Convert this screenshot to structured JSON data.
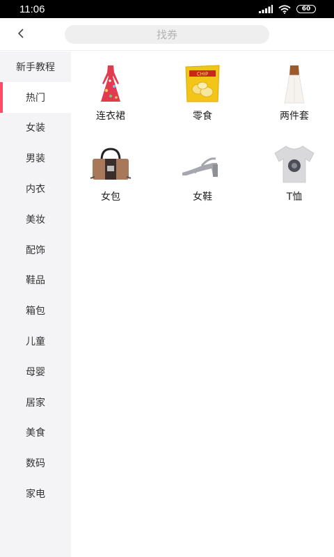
{
  "status": {
    "time": "11:06",
    "battery": "60"
  },
  "header": {
    "search_placeholder": "找券"
  },
  "sidebar": {
    "items": [
      {
        "label": "新手教程"
      },
      {
        "label": "热门"
      },
      {
        "label": "女装"
      },
      {
        "label": "男装"
      },
      {
        "label": "内衣"
      },
      {
        "label": "美妆"
      },
      {
        "label": "配饰"
      },
      {
        "label": "鞋品"
      },
      {
        "label": "箱包"
      },
      {
        "label": "儿童"
      },
      {
        "label": "母婴"
      },
      {
        "label": "居家"
      },
      {
        "label": "美食"
      },
      {
        "label": "数码"
      },
      {
        "label": "家电"
      }
    ],
    "active_index": 1
  },
  "categories": [
    {
      "label": "连衣裙",
      "icon": "dress-icon"
    },
    {
      "label": "零食",
      "icon": "snack-icon"
    },
    {
      "label": "两件套",
      "icon": "two-piece-icon"
    },
    {
      "label": "女包",
      "icon": "handbag-icon"
    },
    {
      "label": "女鞋",
      "icon": "heels-icon"
    },
    {
      "label": "T恤",
      "icon": "tshirt-icon"
    }
  ],
  "colors": {
    "accent": "#ff4a68",
    "sidebar_bg": "#f4f4f6"
  }
}
